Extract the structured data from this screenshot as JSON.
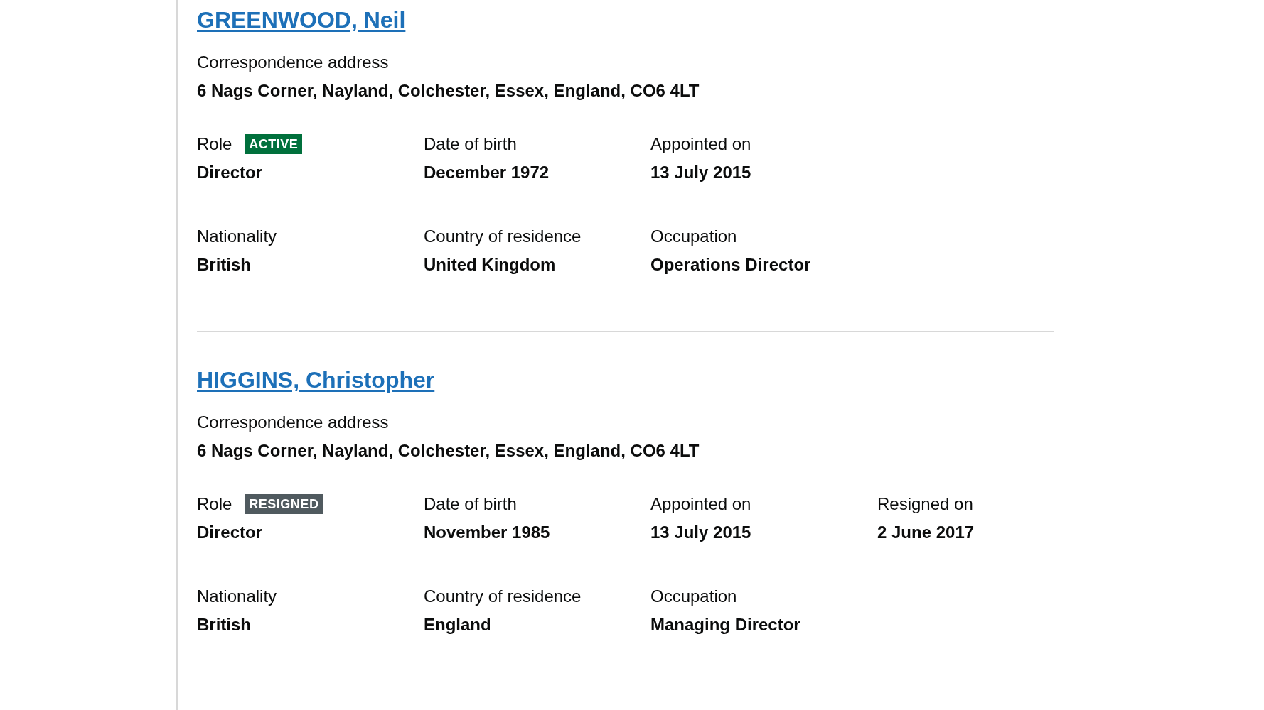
{
  "officers": [
    {
      "name": "GREENWOOD, Neil",
      "address_label": "Correspondence address",
      "address": "6 Nags Corner, Nayland, Colchester, Essex, England, CO6 4LT",
      "rows": [
        [
          {
            "label": "Role",
            "value": "Director",
            "badge": {
              "text": "ACTIVE",
              "kind": "active"
            }
          },
          {
            "label": "Date of birth",
            "value": "December 1972"
          },
          {
            "label": "Appointed on",
            "value": "13 July 2015"
          }
        ],
        [
          {
            "label": "Nationality",
            "value": "British"
          },
          {
            "label": "Country of residence",
            "value": "United Kingdom"
          },
          {
            "label": "Occupation",
            "value": "Operations Director"
          }
        ]
      ]
    },
    {
      "name": "HIGGINS, Christopher",
      "address_label": "Correspondence address",
      "address": "6 Nags Corner, Nayland, Colchester, Essex, England, CO6 4LT",
      "rows": [
        [
          {
            "label": "Role",
            "value": "Director",
            "badge": {
              "text": "RESIGNED",
              "kind": "resigned"
            }
          },
          {
            "label": "Date of birth",
            "value": "November 1985"
          },
          {
            "label": "Appointed on",
            "value": "13 July 2015"
          },
          {
            "label": "Resigned on",
            "value": "2 June 2017"
          }
        ],
        [
          {
            "label": "Nationality",
            "value": "British"
          },
          {
            "label": "Country of residence",
            "value": "England"
          },
          {
            "label": "Occupation",
            "value": "Managing Director"
          }
        ]
      ]
    }
  ]
}
